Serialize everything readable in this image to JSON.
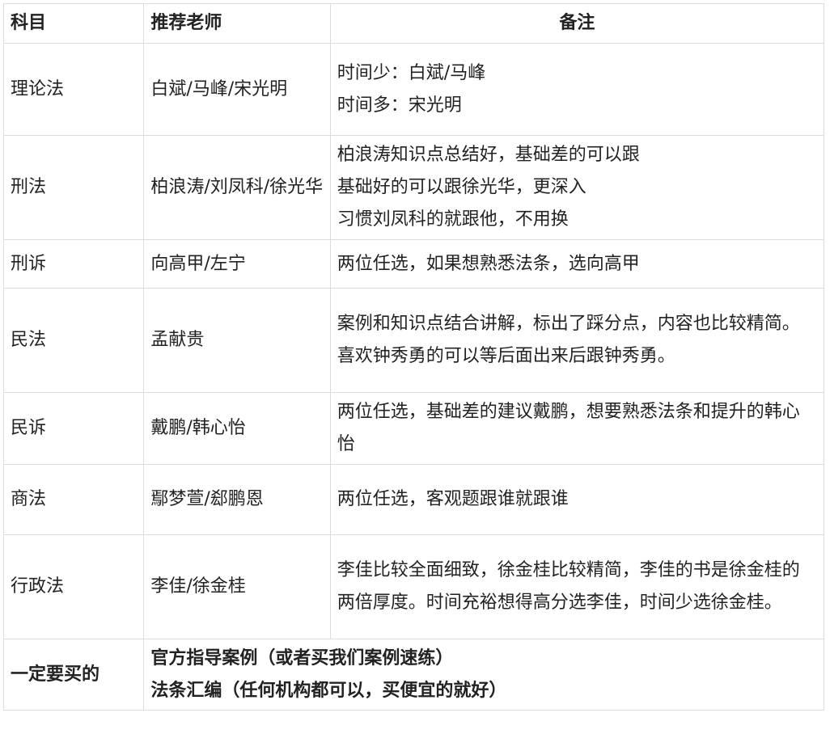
{
  "headers": {
    "subject": "科目",
    "teacher": "推荐老师",
    "note": "备注"
  },
  "rows": [
    {
      "subject": "理论法",
      "teacher": "白斌/马峰/宋光明",
      "notes": [
        "时间少：白斌/马峰",
        "时间多：宋光明"
      ]
    },
    {
      "subject": "刑法",
      "teacher": "柏浪涛/刘凤科/徐光华",
      "notes": [
        "柏浪涛知识点总结好，基础差的可以跟",
        "基础好的可以跟徐光华，更深入",
        "习惯刘凤科的就跟他，不用换"
      ]
    },
    {
      "subject": "刑诉",
      "teacher": "向高甲/左宁",
      "notes": [
        "两位任选，如果想熟悉法条，选向高甲"
      ]
    },
    {
      "subject": "民法",
      "teacher": "孟献贵",
      "notes": [
        "案例和知识点结合讲解，标出了踩分点，内容也比较精简。",
        "喜欢钟秀勇的可以等后面出来后跟钟秀勇。"
      ]
    },
    {
      "subject": "民诉",
      "teacher": "戴鹏/韩心怡",
      "notes": [
        "两位任选，基础差的建议戴鹏，想要熟悉法条和提升的韩心怡"
      ]
    },
    {
      "subject": "商法",
      "teacher": "鄢梦萱/郄鹏恩",
      "notes": [
        "两位任选，客观题跟谁就跟谁"
      ]
    },
    {
      "subject": "行政法",
      "teacher": "李佳/徐金桂",
      "notes": [
        "李佳比较全面细致，徐金桂比较精简，李佳的书是徐金桂的两倍厚度。时间充裕想得高分选李佳，时间少选徐金桂。"
      ]
    }
  ],
  "must_buy": {
    "label": "一定要买的",
    "items": [
      "官方指导案例（或者买我们案例速练）",
      "法条汇编（任何机构都可以，买便宜的就好）"
    ]
  }
}
